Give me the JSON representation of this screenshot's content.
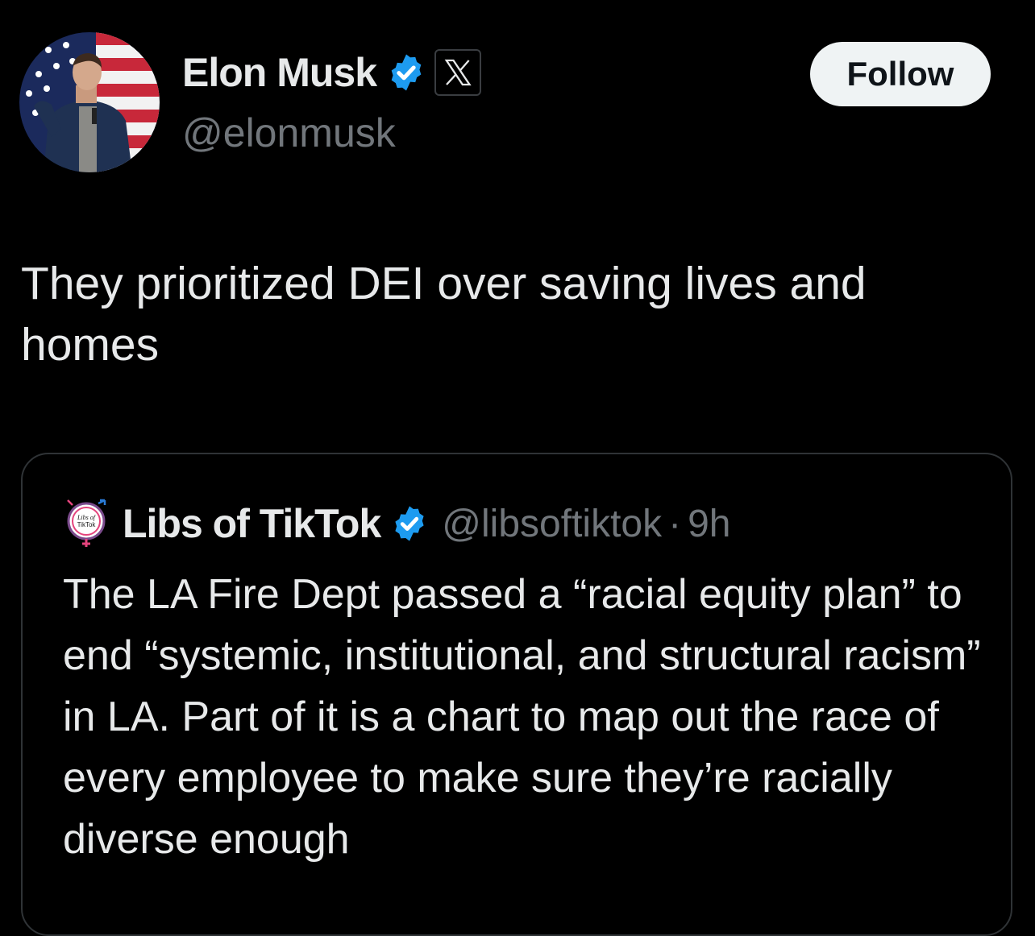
{
  "tweet": {
    "author": {
      "name": "Elon Musk",
      "handle": "@elonmusk",
      "verified": true,
      "affiliation_icon": "x-logo-icon",
      "avatar_icon": "profile-photo-avatar"
    },
    "follow_label": "Follow",
    "text": "They prioritized DEI over saving lives and homes"
  },
  "quoted_tweet": {
    "author": {
      "name": "Libs of TikTok",
      "handle": "@libsoftiktok",
      "verified": true,
      "avatar_icon": "libs-of-tiktok-logo"
    },
    "separator": "·",
    "time": "9h",
    "text": "The LA Fire Dept passed a “racial equity plan” to end “systemic, institutional, and structural racism” in LA. Part of it is a chart to map out the race of every employee to make sure they’re racially diverse enough"
  },
  "colors": {
    "background": "#000000",
    "text_primary": "#e7e9ea",
    "text_secondary": "#71767b",
    "border": "#2f3336",
    "verified_blue": "#1d9bf0",
    "follow_bg": "#eff3f4",
    "follow_text": "#0f1419"
  }
}
